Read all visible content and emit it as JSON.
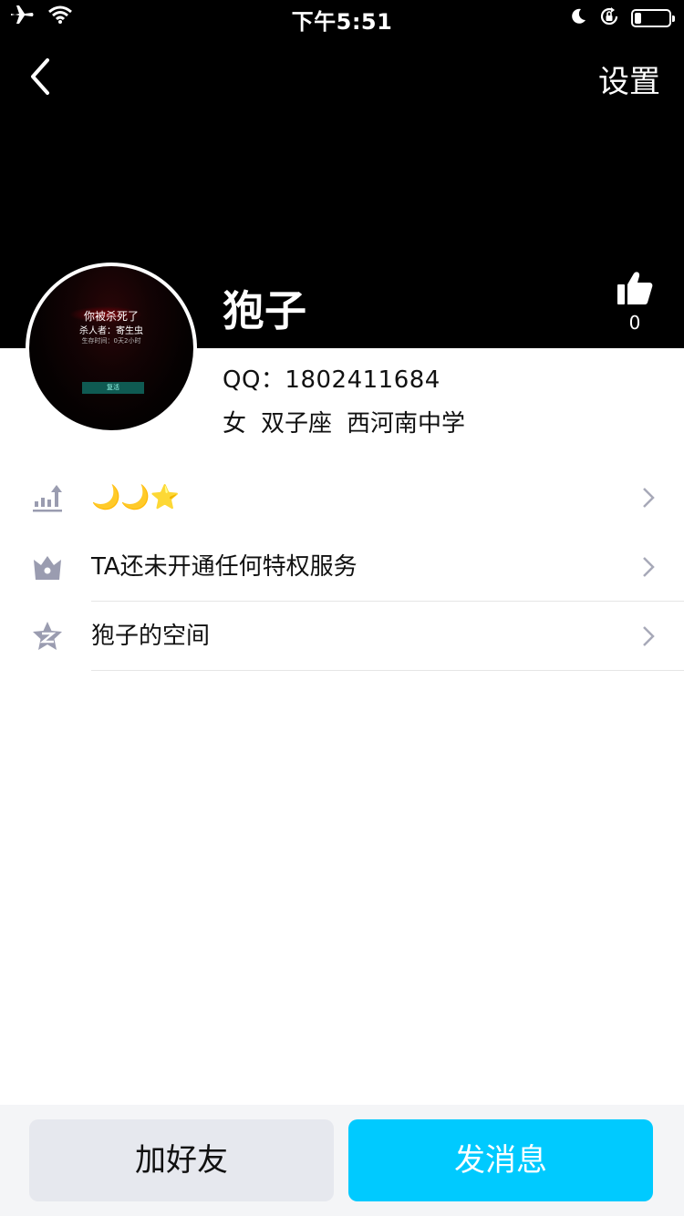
{
  "status_bar": {
    "time": "下午5:51",
    "icons": [
      "airplane-icon",
      "wifi-icon",
      "moon-icon",
      "rotation-lock-icon",
      "battery-icon"
    ],
    "battery_level": 0.2
  },
  "header": {
    "back_icon": "chevron-left-icon",
    "settings_label": "设置",
    "background_color": "#000000"
  },
  "profile": {
    "name": "狍子",
    "avatar_text": {
      "line1": "你被杀死了",
      "line2": "杀人者：寄生虫",
      "line3": "生存时间：0天2小时",
      "button": "复活"
    },
    "likes": {
      "icon": "thumbs-up-icon",
      "count": "0"
    },
    "qq": "QQ：1802411684",
    "gender": "女",
    "zodiac": "双子座",
    "school": "西河南中学"
  },
  "menu": {
    "items": [
      {
        "icon": "level-chart-icon",
        "label": "🌙🌙⭐"
      },
      {
        "icon": "crown-icon",
        "label": "TA还未开通任何特权服务"
      },
      {
        "icon": "qzone-star-icon",
        "label": "狍子的空间"
      }
    ]
  },
  "actions": {
    "add_friend": "加好友",
    "send_message": "发消息"
  },
  "colors": {
    "accent": "#00caff",
    "secondary_button": "#e6e8ee",
    "icon_gray": "#9a9cb0"
  }
}
